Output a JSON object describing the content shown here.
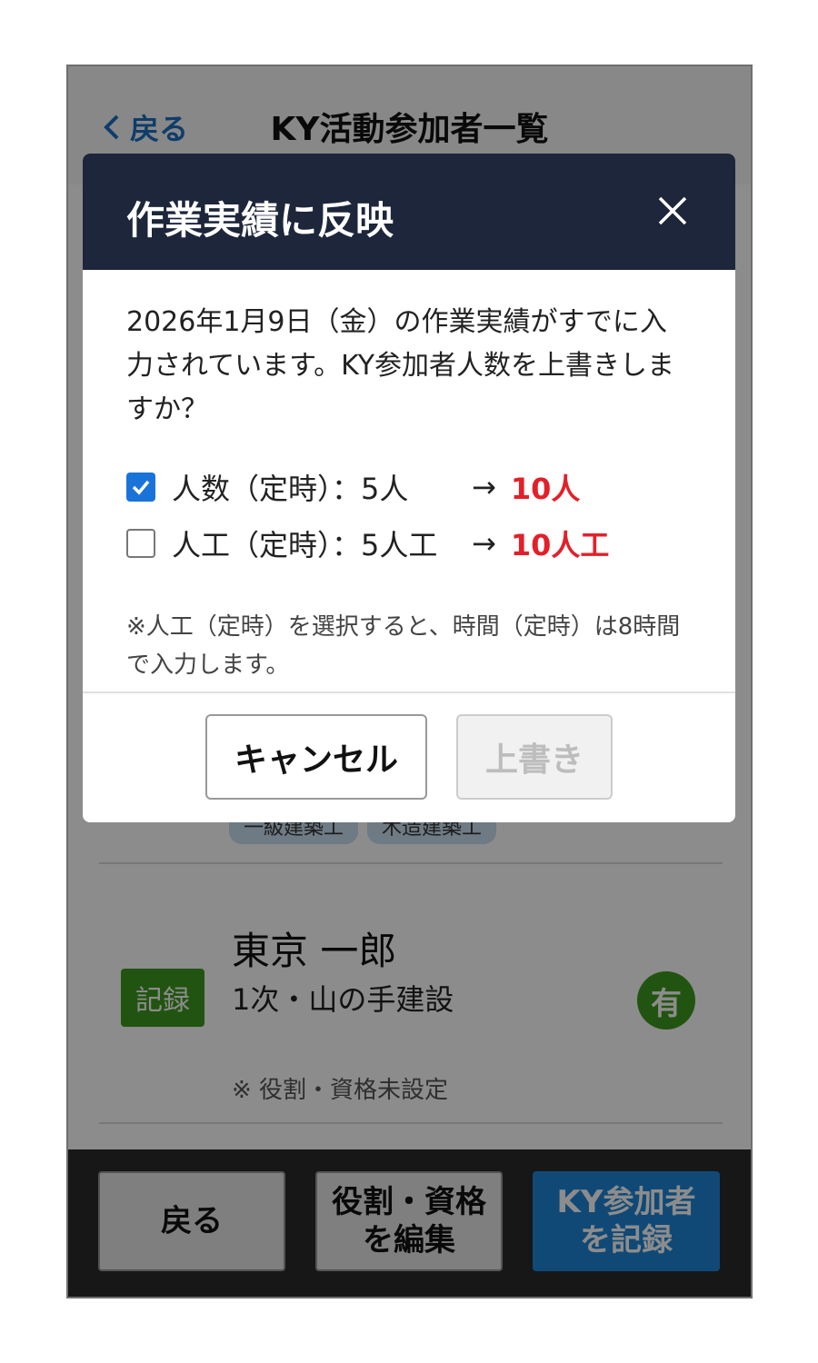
{
  "header": {
    "back_label": "戻る",
    "title": "KY活動参加者一覧"
  },
  "list": {
    "tags": [
      "一級建築工",
      "木造建築工"
    ],
    "person": {
      "badge": "記録",
      "name": "東京 一郎",
      "affiliation": "1次・山の手建設",
      "status": "有",
      "note": "※ 役割・資格未設定"
    }
  },
  "footer": {
    "back": "戻る",
    "edit": "役割・資格\nを編集",
    "record": "KY参加者\nを記録"
  },
  "modal": {
    "title": "作業実績に反映",
    "message": "2026年1月9日（金）の作業実績がすでに入力されています。KY参加者人数を上書きしますか？",
    "options": [
      {
        "label": "人数（定時）：5人",
        "arrow": "→",
        "new_value": "10人",
        "checked": true
      },
      {
        "label": "人工（定時）：5人工",
        "arrow": "→",
        "new_value": "10人工",
        "checked": false
      }
    ],
    "note": "※人工（定時）を選択すると、時間（定時）は8時間で入力します。",
    "cancel": "キャンセル",
    "overwrite": "上書き"
  },
  "colors": {
    "accent": "#1a73d9",
    "header_bg": "#1d263a",
    "new_value": "#e3202a",
    "badge": "#3f9a1f"
  }
}
